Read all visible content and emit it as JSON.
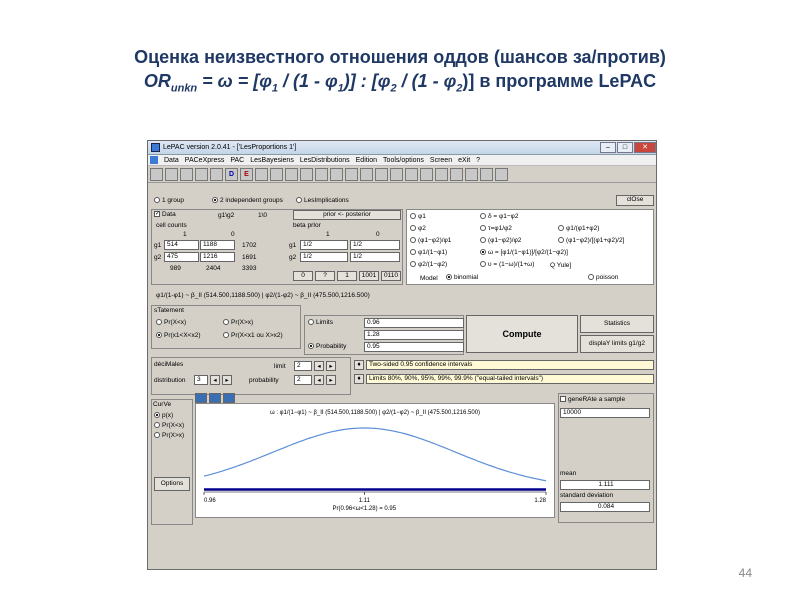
{
  "slide": {
    "title_line1": "Оценка неизвестного отношения оддов (шансов за/против)",
    "title_line2_prefix": "OR",
    "title_line2_sub": "unkn",
    "title_line2_eq": " = ω = [φ",
    "title_line2_mid1": " / (1 - φ",
    "title_line2_mid2": ")] : [φ",
    "title_line2_mid3": " / (1 - φ",
    "title_line2_end": ")] в программе LePAC",
    "sub1": "1",
    "sub2": "2",
    "page_number": "44"
  },
  "window": {
    "title": "LePAC version 2.0.41 - ['LesProportions 1']",
    "menu": [
      "Data",
      "PAC",
      "PAC",
      "LesBayesiens",
      "LesDistributions",
      "Edition",
      "Tools/options",
      "Screen",
      "eXit",
      "?"
    ],
    "toolbar": [
      "",
      "",
      "",
      "",
      "",
      "D",
      "E",
      "",
      "",
      "",
      "",
      "",
      "",
      "",
      "",
      "",
      "",
      "",
      "",
      "",
      "",
      "",
      "",
      "",
      ""
    ]
  },
  "groups": {
    "opt1": "1 group",
    "opt2": "2 independent groups",
    "opt3": "LesImplications",
    "close": "clOse"
  },
  "data_panel": {
    "data_label": "Data",
    "g1g2": "g1\\g2",
    "ratio": "1\\0",
    "prior_post": "prior <- posterior",
    "cell_counts": "cell counts",
    "col1": "1",
    "col0": "0",
    "g1": "g1",
    "g2": "g2",
    "g1_v1": "514",
    "g1_v0": "1188",
    "g1_tot": "1702",
    "g2_v1": "475",
    "g2_v0": "1216",
    "g2_tot": "1691",
    "tot1": "989",
    "tot0": "2404",
    "tot": "3393",
    "beta_prior": "beta prIor",
    "bcol1": "1",
    "bcol0": "0",
    "bg1_1": "1/2",
    "bg1_0": "1/2",
    "bg2_1": "1/2",
    "bg2_0": "1/2",
    "btns": [
      "0",
      "?",
      "1",
      "1001",
      "0110"
    ]
  },
  "params": {
    "r1": [
      "φ1",
      "δ = φ1−φ2"
    ],
    "r2": [
      "φ2",
      "τ=φ1/φ2",
      "φ1/(φ1+φ2)"
    ],
    "r3": [
      "(φ1−φ2)/φ1",
      "(φ1−φ2)/φ2",
      "(φ1−φ2)/[(φ1+φ2)/2]"
    ],
    "r4": [
      "φ1/(1−φ1)",
      "ω = [φ1/(1−φ1)]/[φ2/(1−φ2)]"
    ],
    "r5": [
      "φ2/(1−φ2)",
      "υ = (1−ω)/(1+ω)",
      "Q Yule]"
    ],
    "model": "Model",
    "binomial": "binomial",
    "poisson": "poisson"
  },
  "formula": "φ1/(1-φ1) ~ β_II (514.500,1188.500) | φ2/(1-φ2) ~ β_II (475.500,1216.500)",
  "statement": {
    "title": "sTatement",
    "a": "Pr(X<x)",
    "b": "Pr(X>x)",
    "c": "Pr(x1<X<x2)",
    "d": "Pr(X<x1 ou X>x2)"
  },
  "limits": {
    "limits": "Limits",
    "probability": "Probability",
    "v1": "0.96",
    "v2": "1.28",
    "v3": "0.95",
    "compute": "Compute",
    "statistics": "Statistics",
    "display": "displaY limits g1/g2"
  },
  "decimals": {
    "title": "déciMales",
    "limit": "limit",
    "limit_v": "2",
    "distribution": "distribution",
    "dist_v": "3",
    "probability": "probability",
    "prob_v": "2",
    "sel1": "Two-sided 0.95 confidence intervals",
    "sel2": "Limits 80%, 90%, 95%, 99%, 99.9% (\"equal-tailed intervals\")"
  },
  "curve": {
    "title": "CurVe",
    "o1": "p(x)",
    "o2": "Pr(X<x)",
    "o3": "Pr(X>x)",
    "options": "Options"
  },
  "chart_data": {
    "type": "line",
    "title": "ω : φ1/(1−φ1) ~ β_II (514.500,1188.500) | φ2/(1−φ2) ~ β_II (475.500,1216.500)",
    "x": [
      0.96,
      1.0,
      1.04,
      1.08,
      1.11,
      1.14,
      1.18,
      1.22,
      1.28
    ],
    "values": [
      0.12,
      0.3,
      0.62,
      0.92,
      1.0,
      0.92,
      0.66,
      0.36,
      0.1
    ],
    "x_ticks": [
      "0.96",
      "1.11",
      "1.28"
    ],
    "xlabel": "Pr(0.96<ω<1.28) = 0.95",
    "xlim": [
      0.96,
      1.28
    ],
    "ylim": [
      0,
      1.0
    ]
  },
  "generate": {
    "label": "geneRAte a sample",
    "value": "10000",
    "mean_label": "mean",
    "mean": "1.111",
    "sd_label": "standard deviation",
    "sd": "0.084"
  }
}
